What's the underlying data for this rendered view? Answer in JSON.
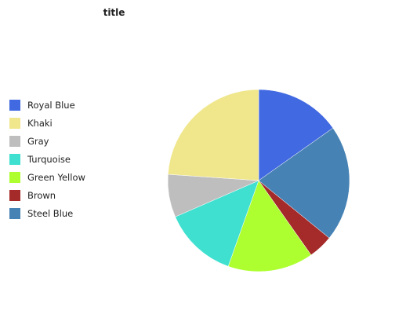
{
  "chart_data": {
    "type": "pie",
    "title": "title",
    "legend_position": "left",
    "start_angle_deg": 90,
    "direction": "clockwise",
    "slices": [
      {
        "label": "Royal Blue",
        "value": 14,
        "color": "#4169e1"
      },
      {
        "label": "Steel Blue",
        "value": 19,
        "color": "#4682b4"
      },
      {
        "label": "Brown",
        "value": 4,
        "color": "#a52a2a"
      },
      {
        "label": "Green Yellow",
        "value": 14,
        "color": "#adff2f"
      },
      {
        "label": "Turquoise",
        "value": 12,
        "color": "#40e0d0"
      },
      {
        "label": "Gray",
        "value": 7,
        "color": "#bebebe"
      },
      {
        "label": "Khaki",
        "value": 22,
        "color": "#f0e68c"
      }
    ],
    "legend": [
      {
        "label": "Royal Blue",
        "color": "#4169e1"
      },
      {
        "label": "Khaki",
        "color": "#f0e68c"
      },
      {
        "label": "Gray",
        "color": "#bebebe"
      },
      {
        "label": "Turquoise",
        "color": "#40e0d0"
      },
      {
        "label": "Green Yellow",
        "color": "#adff2f"
      },
      {
        "label": "Brown",
        "color": "#a52a2a"
      },
      {
        "label": "Steel Blue",
        "color": "#4682b4"
      }
    ]
  }
}
